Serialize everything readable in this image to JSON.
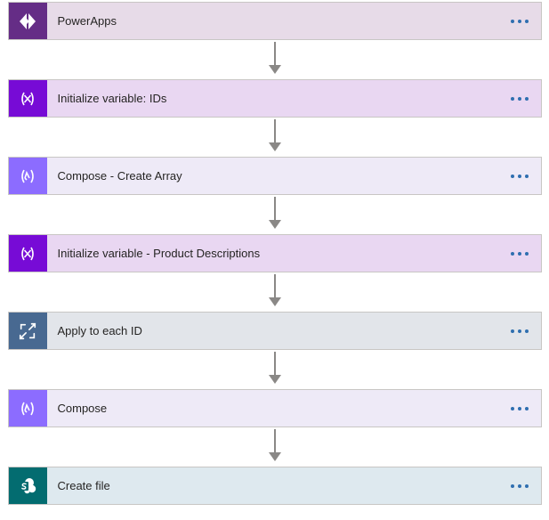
{
  "steps": [
    {
      "label": "PowerApps",
      "theme": "powerapps",
      "icon": "powerapps"
    },
    {
      "label": "Initialize variable: IDs",
      "theme": "var",
      "icon": "variable"
    },
    {
      "label": "Compose - Create Array",
      "theme": "compose",
      "icon": "compose"
    },
    {
      "label": "Initialize variable - Product Descriptions",
      "theme": "var",
      "icon": "variable"
    },
    {
      "label": "Apply to each ID",
      "theme": "each",
      "icon": "loop"
    },
    {
      "label": "Compose",
      "theme": "compose",
      "icon": "compose"
    },
    {
      "label": "Create file",
      "theme": "sp",
      "icon": "sharepoint"
    }
  ],
  "moreButtonAria": "More options"
}
